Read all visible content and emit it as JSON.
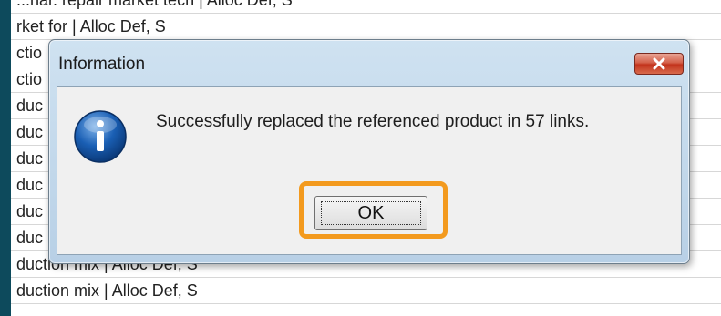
{
  "sheet": {
    "rows": [
      {
        "text": "...nar. repair market tech | Alloc Def, S"
      },
      {
        "text": "rket for | Alloc Def, S"
      },
      {
        "text": "ctio"
      },
      {
        "text": "ctio"
      },
      {
        "text": "duc"
      },
      {
        "text": "duc"
      },
      {
        "text": "duc"
      },
      {
        "text": "duc"
      },
      {
        "text": "duc"
      },
      {
        "text": "duc"
      },
      {
        "text": "duction mix | Alloc Def, S"
      },
      {
        "text": "duction mix | Alloc Def, S"
      }
    ]
  },
  "dialog": {
    "title": "Information",
    "message": "Successfully replaced the referenced product in 57 links.",
    "ok_label": "OK",
    "icon": "info-icon",
    "close_icon": "close-icon"
  },
  "colors": {
    "highlight": "#f39a1e",
    "background": "#0d4a5c",
    "close_button": "#c2331c",
    "info_icon": "#1a5fb4"
  }
}
